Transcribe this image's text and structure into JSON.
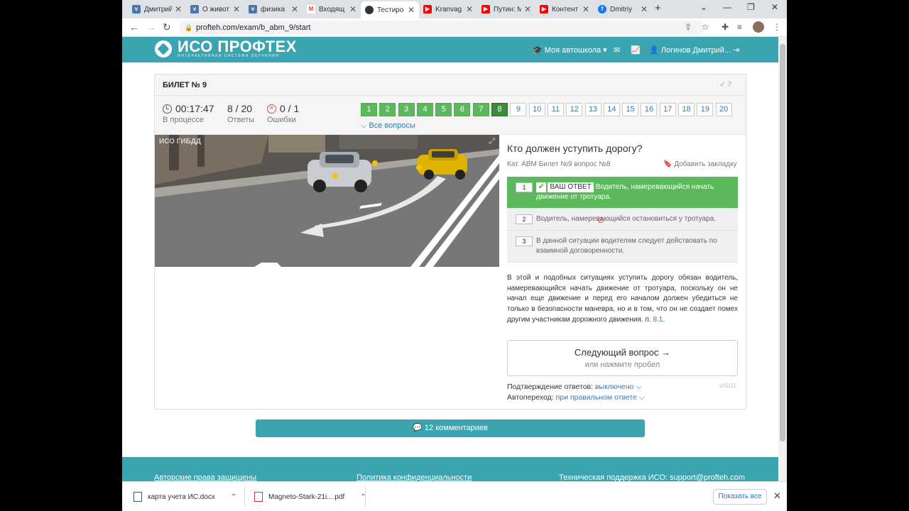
{
  "browser": {
    "tabs": [
      {
        "label": "Дмитрий",
        "icon": "vk-icon",
        "color": "#4a76a8"
      },
      {
        "label": "О живот",
        "icon": "vk-icon",
        "color": "#4a76a8"
      },
      {
        "label": "физика",
        "icon": "vk-icon",
        "color": "#4a76a8"
      },
      {
        "label": "Входящ",
        "icon": "gmail-icon",
        "color": "#ea4335"
      },
      {
        "label": "Тестиро",
        "icon": "profteh-icon",
        "color": "#333333"
      },
      {
        "label": "Kranvag",
        "icon": "youtube-icon",
        "color": "#ff0000"
      },
      {
        "label": "Путин: М",
        "icon": "youtube-icon",
        "color": "#ff0000"
      },
      {
        "label": "Контент",
        "icon": "youtube-icon",
        "color": "#ff0000"
      },
      {
        "label": "Dmitriy",
        "icon": "facebook-icon",
        "color": "#1877f2"
      }
    ],
    "url": "profteh.com/exam/b_abm_9/start"
  },
  "header": {
    "logo_name": "ИСО ПРОФТЕХ",
    "logo_sub": "ИНТЕРАКТИВНАЯ СИСТЕМА ОБУЧЕНИЯ",
    "school": "Моя автошкола",
    "user": "Логинов Дмитрий..."
  },
  "ticket": {
    "title": "БИЛЕТ № 9",
    "count": "✓ 7",
    "time": "00:17:47",
    "time_label": "В процессе",
    "answers": "8 / 20",
    "answers_label": "Ответы",
    "errors": "0 / 1",
    "errors_label": "Ошибки",
    "questions": [
      "1",
      "2",
      "3",
      "4",
      "5",
      "6",
      "7",
      "8",
      "9",
      "10",
      "11",
      "12",
      "13",
      "14",
      "15",
      "16",
      "17",
      "18",
      "19",
      "20"
    ],
    "done_count": 7,
    "current": 8,
    "all_questions": "Все вопросы"
  },
  "scene": {
    "watermark": "ИСО  ГИБДД"
  },
  "question": {
    "text": "Кто должен уступить дорогу?",
    "meta": "Кат. ABM  Билет №9  вопрос №8",
    "bookmark": "Добавить закладку",
    "answers": [
      {
        "num": "1",
        "badge": "ВАШ ОТВЕТ",
        "text": "Водитель, намеревающийся начать движение от тротуара."
      },
      {
        "num": "2",
        "text": "Водитель, намеревающийся остановиться у тротуара."
      },
      {
        "num": "3",
        "text": "В данной ситуации водителям следует действовать по взаимной договоренности."
      }
    ],
    "explanation": "В этой и подобных ситуациях уступить дорогу обязан водитель, намеревающийся начать движение от тротуара, поскольку он не начал еще движение и перед его началом должен убедиться не только в безопасности маневра, но и в том, что он не создает помех другим участникам дорожного движения. п.",
    "explanation_ref": "8.1",
    "next_title": "Следующий вопрос →",
    "next_sub": "или нажмите пробел",
    "confirm_label": "Подтверждение ответов:",
    "confirm_value": "выключено",
    "auto_label": "Автопереход:",
    "auto_value": "при правильном ответе",
    "version": "v01/11"
  },
  "comments": "12 комментариев",
  "footer": {
    "copyright": "Авторские права защищены",
    "privacy": "Политика конфиденциальности",
    "support": "Техническая поддержка ИСО:  support@profteh.com"
  },
  "downloads": {
    "file1": "карта учета ИС.docx",
    "file2": "Magneto-Stark-21i....pdf",
    "show_all": "Показать все"
  },
  "colors": {
    "brand": "#3aa4b1",
    "correct": "#5cb85c"
  }
}
